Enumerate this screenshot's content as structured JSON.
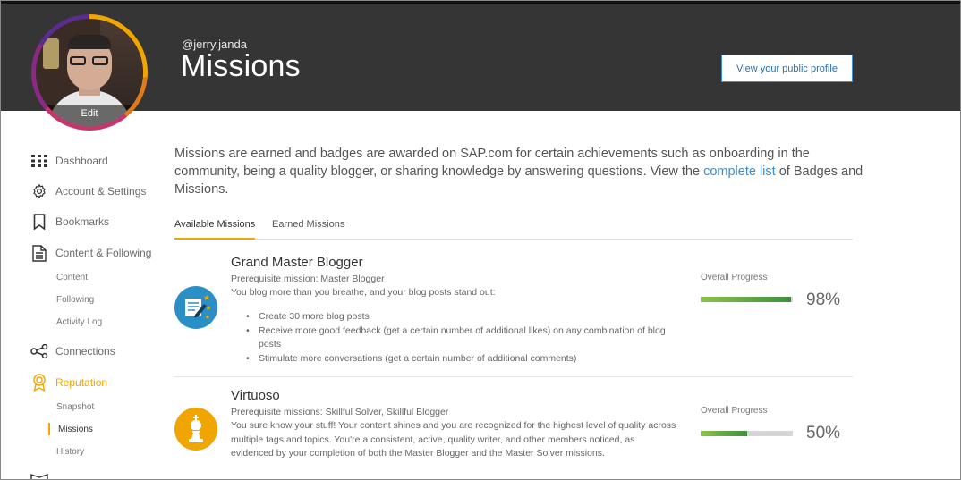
{
  "header": {
    "username": "@jerry.janda",
    "title": "Missions",
    "profile_button": "View your public profile",
    "avatar_edit": "Edit"
  },
  "sidebar": {
    "items": [
      {
        "label": "Dashboard",
        "icon": "grid-icon"
      },
      {
        "label": "Account & Settings",
        "icon": "gear-icon"
      },
      {
        "label": "Bookmarks",
        "icon": "bookmark-icon"
      },
      {
        "label": "Content & Following",
        "icon": "document-icon"
      },
      {
        "label": "Connections",
        "icon": "share-icon"
      },
      {
        "label": "Reputation",
        "icon": "award-icon"
      }
    ],
    "content_sub": [
      "Content",
      "Following",
      "Activity Log"
    ],
    "reputation_sub": [
      "Snapshot",
      "Missions",
      "History"
    ],
    "accent": "#f0a500"
  },
  "intro": {
    "before": "Missions are earned and badges are awarded on SAP.com for certain achievements such as onboarding in the community, being a quality blogger, or sharing knowledge by answering questions. View the ",
    "link": "complete list",
    "after": " of Badges and Missions."
  },
  "tabs": [
    {
      "label": "Available Missions",
      "active": true
    },
    {
      "label": "Earned Missions",
      "active": false
    }
  ],
  "missions": [
    {
      "title": "Grand Master Blogger",
      "prereq": "Prerequisite mission: Master Blogger",
      "description": "You blog more than you breathe, and your blog posts stand out:",
      "bullets": [
        "Create 30 more blog posts",
        "Receive more good feedback (get a certain number of additional likes) on any combination of blog posts",
        "Stimulate more conversations (get a certain number of additional comments)"
      ],
      "progress_label": "Overall Progress",
      "progress": 0.98,
      "progress_text": "98%",
      "icon": "blog-badge-icon",
      "icon_color": "#2a8fc7"
    },
    {
      "title": "Virtuoso",
      "prereq": "Prerequisite missions: Skillful Solver, Skillful Blogger",
      "description": "You sure know your stuff! Your content shines and you are recognized for the highest level of quality across multiple tags and topics. You're a consistent, active, quality writer, and other members noticed, as evidenced by your completion of both the Master Blogger and the Master Solver missions.",
      "progress_label": "Overall Progress",
      "progress": 0.5,
      "progress_text": "50%",
      "icon": "chess-piece-icon",
      "icon_color": "#f0a500"
    }
  ]
}
